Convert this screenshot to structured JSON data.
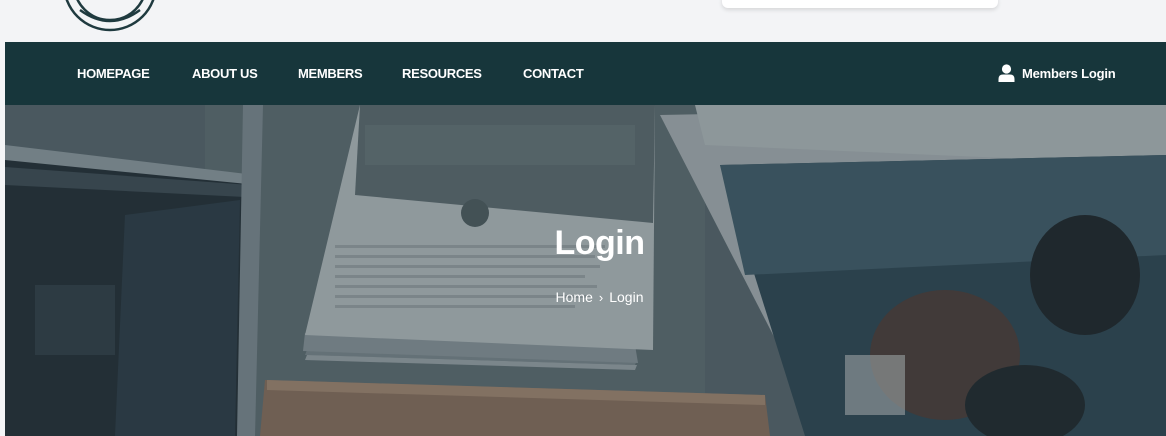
{
  "nav": {
    "items": [
      "HOMEPAGE",
      "ABOUT US",
      "MEMBERS",
      "RESOURCES",
      "CONTACT"
    ],
    "members_login": "Members Login",
    "members_login_icon": "user-icon"
  },
  "hero": {
    "title": "Login",
    "breadcrumb": {
      "home": "Home",
      "separator": "›",
      "current": "Login"
    }
  },
  "colors": {
    "nav_bg": "#17363b",
    "top_bg": "#f3f4f6",
    "text": "#ffffff"
  }
}
